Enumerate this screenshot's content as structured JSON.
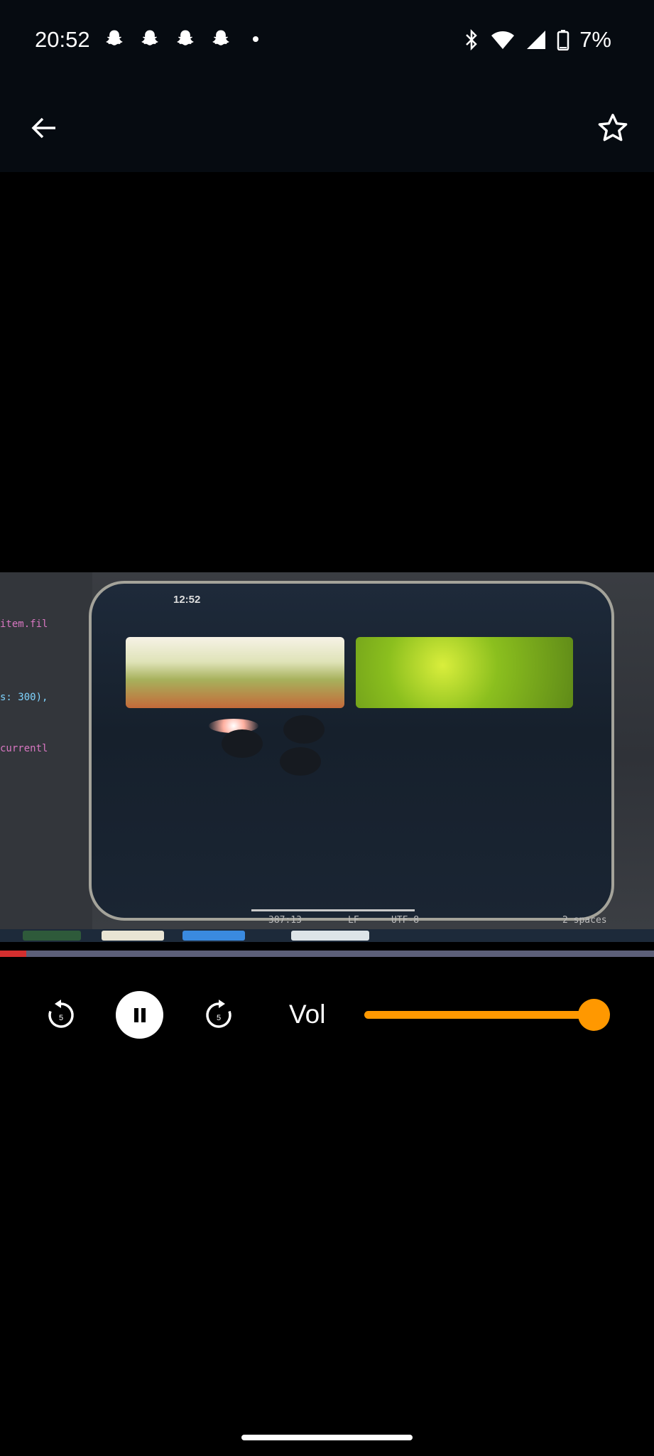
{
  "status_bar": {
    "time": "20:52",
    "notification_icons": [
      "snapchat-icon",
      "snapchat-icon",
      "snapchat-icon",
      "snapchat-icon"
    ],
    "battery": "7%"
  },
  "video": {
    "phone_time": "12:52",
    "code_lines": [
      "item.fil",
      "s: 300),",
      "currentl"
    ],
    "editor_footer": [
      "387:13",
      "LF",
      "UTF-8",
      "2 spaces"
    ]
  },
  "player": {
    "progress": 0.04,
    "progress_color": "#d32f2f",
    "rewind_seconds": "5",
    "forward_seconds": "5",
    "volume_label": "Vol",
    "volume_level": 1.0,
    "accent": "#ff9800"
  }
}
